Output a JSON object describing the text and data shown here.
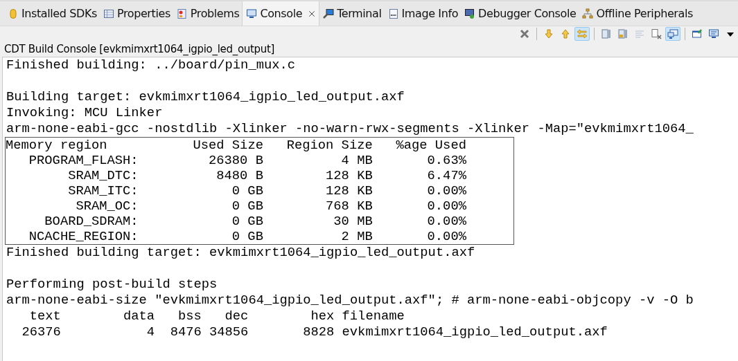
{
  "tabs": [
    {
      "label": "Installed SDKs",
      "selected": false
    },
    {
      "label": "Properties",
      "selected": false
    },
    {
      "label": "Problems",
      "selected": false
    },
    {
      "label": "Console",
      "selected": true
    },
    {
      "label": "Terminal",
      "selected": false
    },
    {
      "label": "Image Info",
      "selected": false
    },
    {
      "label": "Debugger Console",
      "selected": false
    },
    {
      "label": "Offline Peripherals",
      "selected": false
    }
  ],
  "toolbar": {
    "groups": [
      [
        {
          "pressed": false,
          "disabled": false
        }
      ],
      [
        {
          "pressed": false,
          "disabled": false
        },
        {
          "pressed": false,
          "disabled": false
        },
        {
          "pressed": true,
          "disabled": false
        }
      ],
      [
        {
          "pressed": false,
          "disabled": false
        },
        {
          "pressed": false,
          "disabled": false
        },
        {
          "pressed": false,
          "disabled": true
        },
        {
          "pressed": false,
          "disabled": false
        },
        {
          "pressed": true,
          "disabled": false
        }
      ],
      [
        {
          "pressed": false,
          "disabled": false
        },
        {
          "pressed": false,
          "disabled": false
        },
        {
          "pressed": false,
          "disabled": false
        }
      ]
    ]
  },
  "console": {
    "title": "CDT Build Console [evkmimxrt1064_igpio_led_output]",
    "blocks_before": [
      [
        "Finished building: ../board/pin_mux.c"
      ],
      [
        "Building target: evkmimxrt1064_igpio_led_output.axf",
        "Invoking: MCU Linker",
        "arm-none-eabi-gcc -nostdlib -Xlinker -no-warn-rwx-segments -Xlinker -Map=\"evkmimxrt1064_"
      ]
    ],
    "memory_table": {
      "columns": [
        "Memory region",
        "Used Size",
        "Region Size",
        "%age Used"
      ],
      "rows": [
        [
          "PROGRAM_FLASH:",
          "26380 B",
          "4 MB",
          "0.63%"
        ],
        [
          "SRAM_DTC:",
          "8480 B",
          "128 KB",
          "6.47%"
        ],
        [
          "SRAM_ITC:",
          "0 GB",
          "128 KB",
          "0.00%"
        ],
        [
          "SRAM_OC:",
          "0 GB",
          "768 KB",
          "0.00%"
        ],
        [
          "BOARD_SDRAM:",
          "0 GB",
          "30 MB",
          "0.00%"
        ],
        [
          "NCACHE_REGION:",
          "0 GB",
          "2 MB",
          "0.00%"
        ]
      ]
    },
    "blocks_after": [
      [
        "Finished building target: evkmimxrt1064_igpio_led_output.axf"
      ],
      [
        "Performing post-build steps",
        "arm-none-eabi-size \"evkmimxrt1064_igpio_led_output.axf\"; # arm-none-eabi-objcopy -v -O b"
      ]
    ],
    "size_table": {
      "columns": [
        "text",
        "data",
        "bss",
        "dec",
        "hex",
        "filename"
      ],
      "rows": [
        [
          "26376",
          "4",
          "8476",
          "34856",
          "8828",
          "evkmimxrt1064_igpio_led_output.axf"
        ]
      ]
    }
  }
}
